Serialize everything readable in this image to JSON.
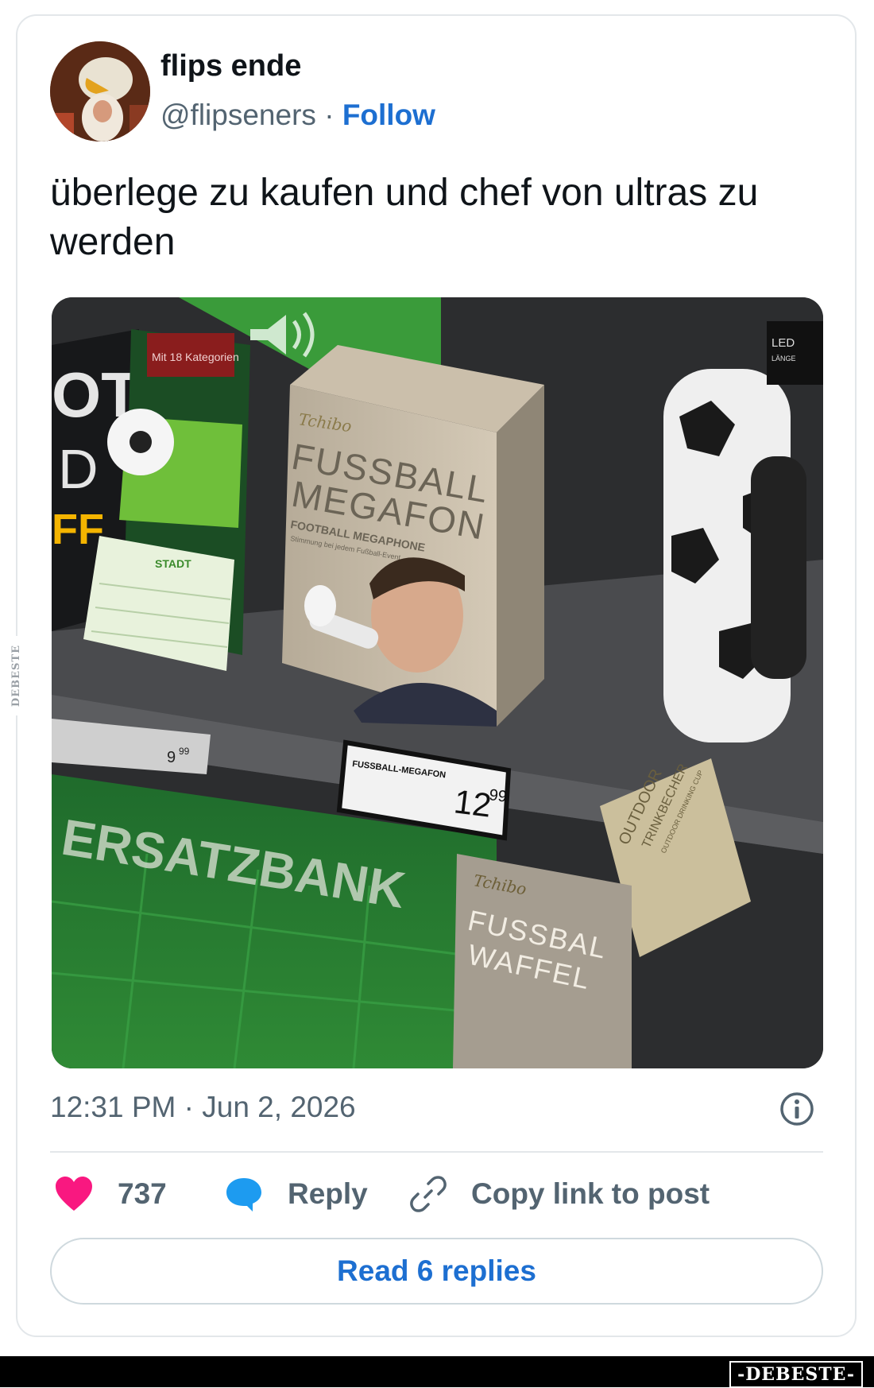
{
  "tweet": {
    "author_name": "flips ende",
    "handle": "@flipseners",
    "separator": "·",
    "follow_label": "Follow",
    "text": "überlege zu kaufen und chef von ultras zu werden",
    "timestamp": "12:31 PM · Jun 2, 2026"
  },
  "photo": {
    "category_card": "Mit 18 Kategorien",
    "left_box_partial": "OT",
    "left_box_partial2": "D",
    "left_box_partial3": "FF",
    "scorecard": "STADT",
    "brand": "Tchibo",
    "product_line1": "FUSSBALL",
    "product_line2": "MEGAFON",
    "product_sub": "FOOTBALL MEGAPHONE",
    "product_tagline": "Stimmung bei jedem Fußball-Event",
    "price_label_small": "9",
    "price_small_cents": "99",
    "price_label_name": "FUSSBALL-MEGAFON",
    "price_main": "12",
    "price_main_cents": "99",
    "banner_text": "ERSATZBANK",
    "tag_line1": "OUTDOOR",
    "tag_line2": "TRINKBECHER",
    "tag_line3": "OUTDOOR DRINKING CUP",
    "bottom_brand": "Tchibo",
    "bottom_box_line1": "FUSSBAL",
    "bottom_box_line2": "WAFFEL",
    "corner_label": "LED",
    "corner_label2": "LÄNGE"
  },
  "actions": {
    "like_count": "737",
    "reply_label": "Reply",
    "copy_label": "Copy link to post",
    "read_replies_label": "Read 6 replies"
  },
  "watermark": {
    "side": "DEBESTE",
    "bottom": "-DEBESTE-"
  },
  "colors": {
    "like": "#f91880",
    "reply": "#1d9bf0",
    "link": "#1d6fd1",
    "muted": "#536471"
  },
  "icons": [
    "heart-icon",
    "speech-bubble-icon",
    "link-icon",
    "info-icon"
  ]
}
